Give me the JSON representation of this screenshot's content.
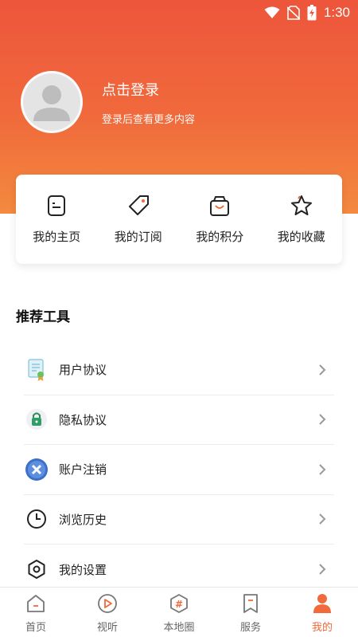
{
  "status_bar": {
    "time": "1:30",
    "icons": [
      "wifi-icon",
      "no-sim-icon",
      "battery-charging-icon"
    ]
  },
  "profile": {
    "title": "点击登录",
    "subtitle": "登录后查看更多内容"
  },
  "quick_actions": [
    {
      "label": "我的主页",
      "icon": "homepage-icon"
    },
    {
      "label": "我的订阅",
      "icon": "tag-icon"
    },
    {
      "label": "我的积分",
      "icon": "shopping-bag-icon"
    },
    {
      "label": "我的收藏",
      "icon": "star-icon"
    }
  ],
  "tools": {
    "title": "推荐工具",
    "items": [
      {
        "label": "用户协议",
        "icon": "certificate-icon"
      },
      {
        "label": "隐私协议",
        "icon": "lock-icon"
      },
      {
        "label": "账户注销",
        "icon": "cancel-x-icon"
      },
      {
        "label": "浏览历史",
        "icon": "clock-icon"
      },
      {
        "label": "我的设置",
        "icon": "settings-icon"
      }
    ]
  },
  "tabbar": {
    "items": [
      {
        "label": "首页",
        "icon": "home-icon"
      },
      {
        "label": "视听",
        "icon": "play-icon"
      },
      {
        "label": "本地圈",
        "icon": "local-hash-icon"
      },
      {
        "label": "服务",
        "icon": "bookmark-icon"
      },
      {
        "label": "我的",
        "icon": "person-icon"
      }
    ],
    "active_index": 4
  },
  "colors": {
    "header_top": "#ee553b",
    "header_bottom": "#f38a3e",
    "accent": "#f06a3c"
  }
}
